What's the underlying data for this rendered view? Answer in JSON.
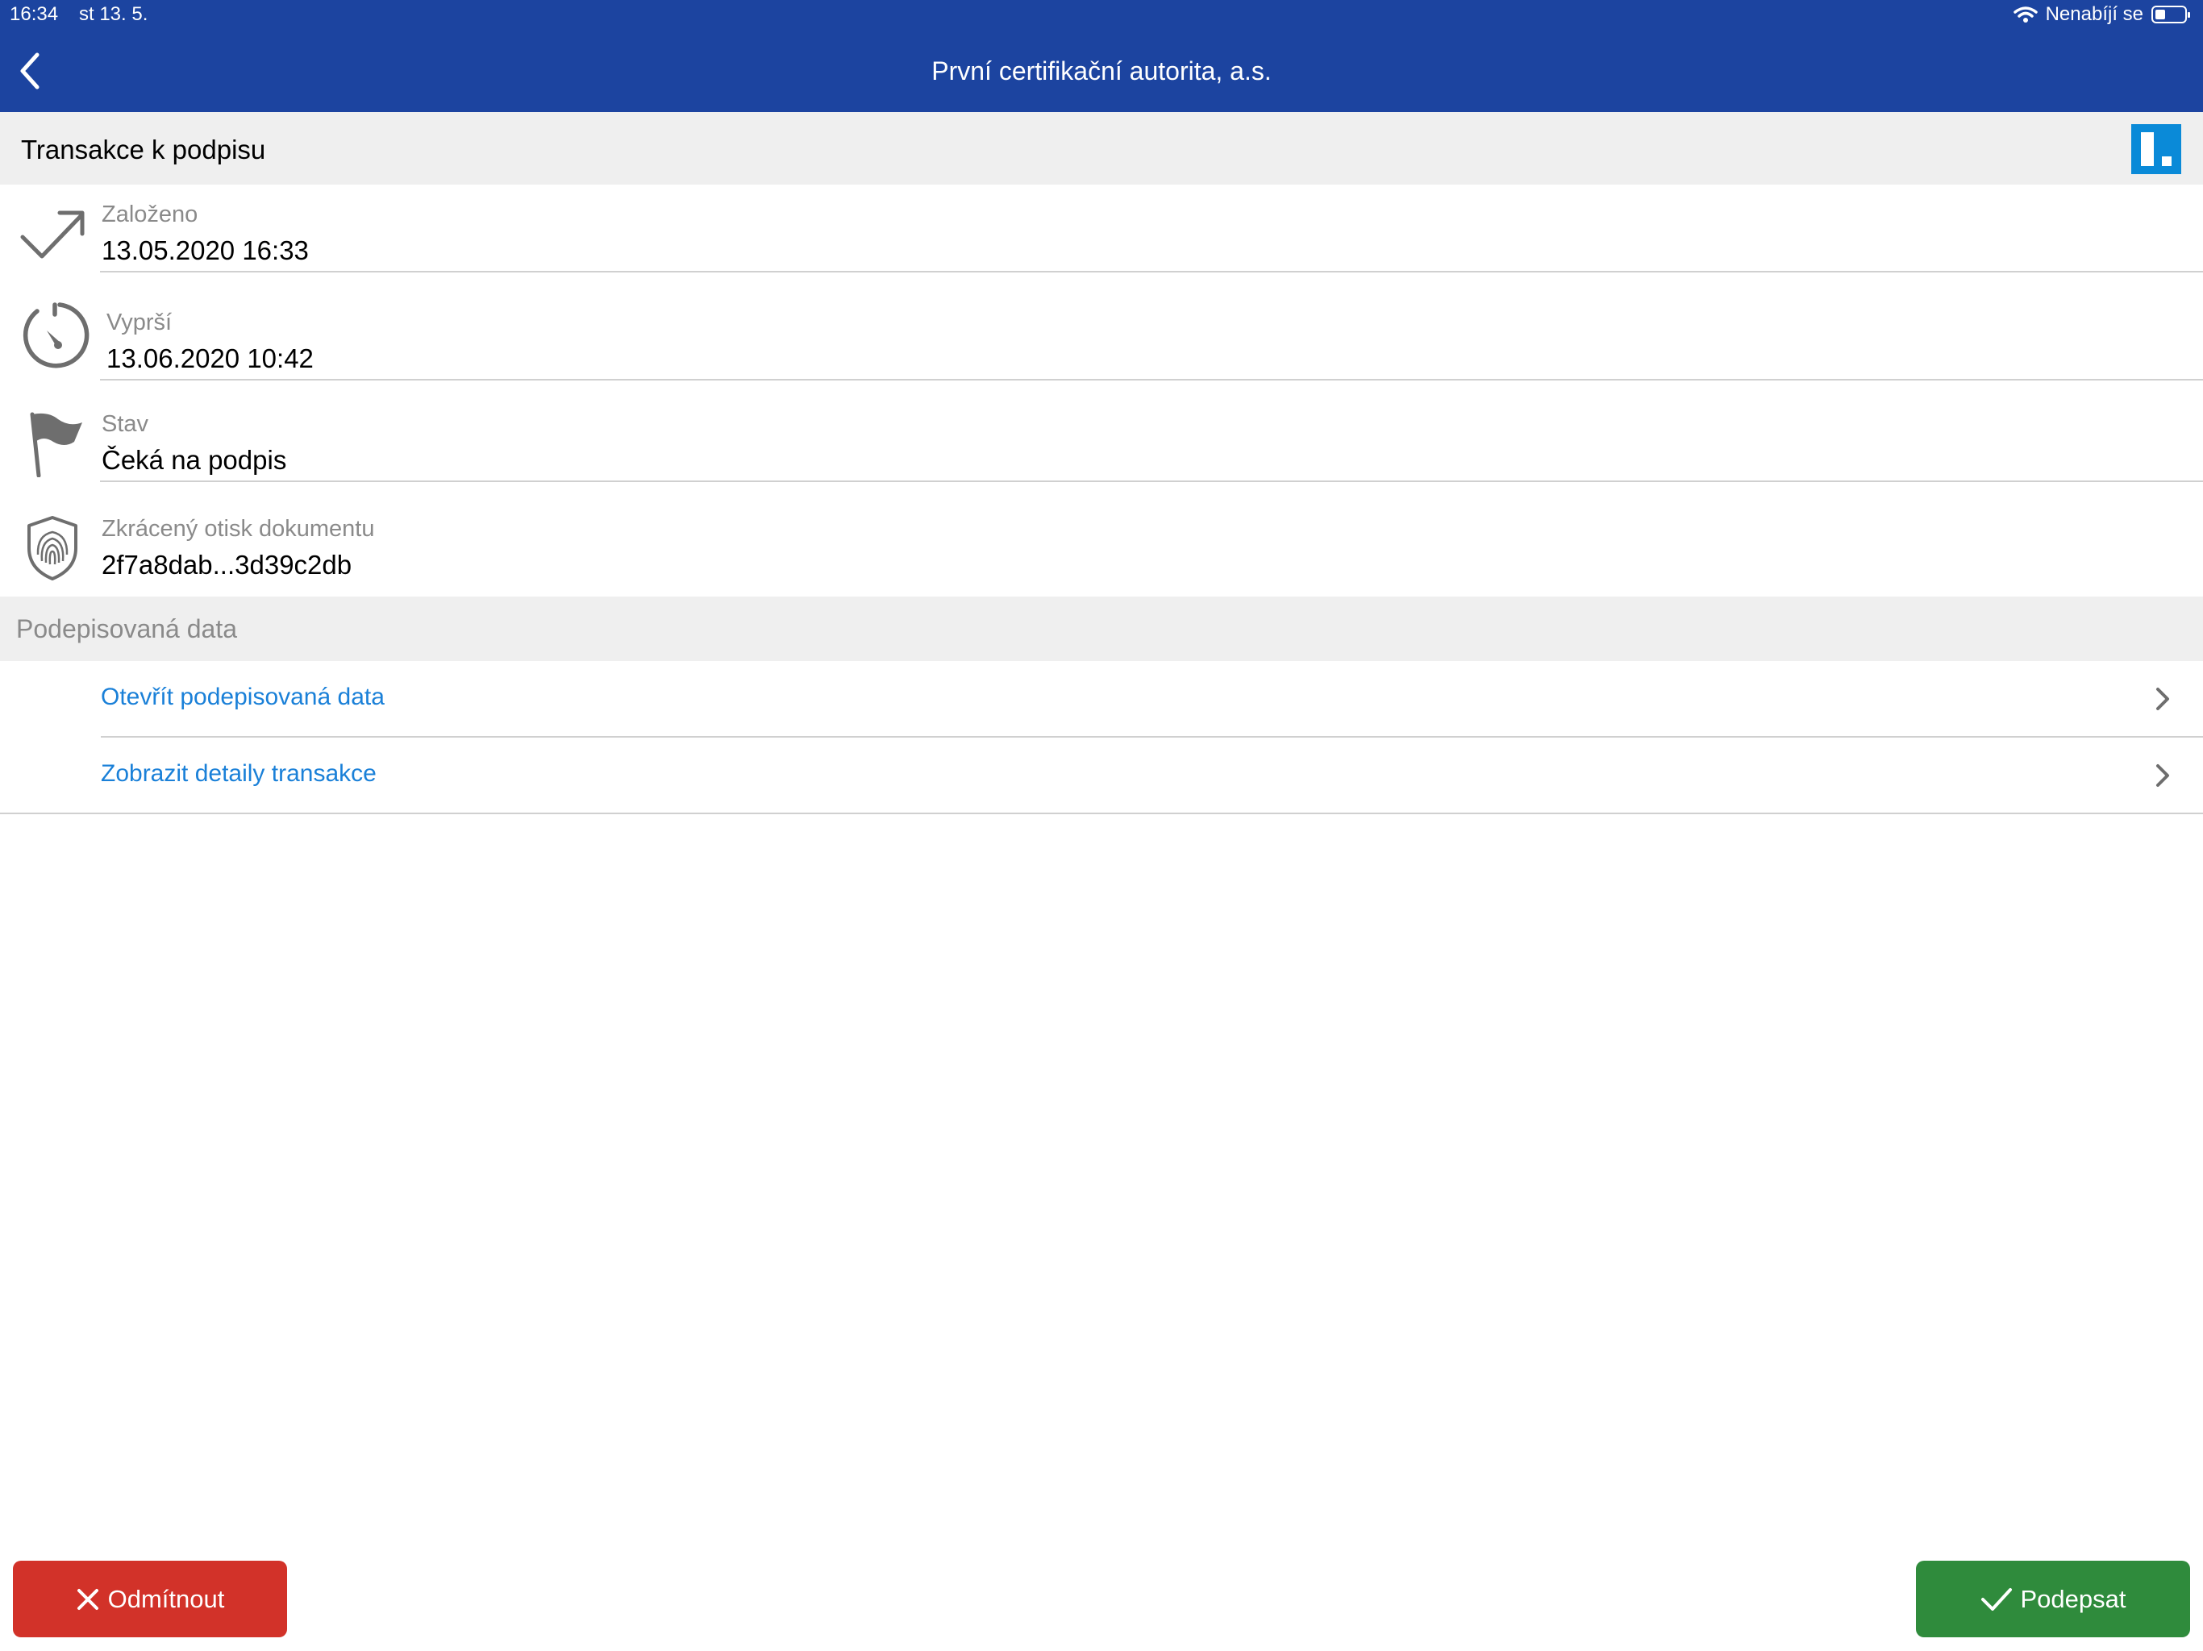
{
  "status_bar": {
    "time": "16:34",
    "date": "st 13. 5.",
    "charging": "Nenabíjí se"
  },
  "nav": {
    "title": "První certifikační autorita, a.s."
  },
  "header": {
    "title": "Transakce k podpisu"
  },
  "fields": [
    {
      "label": "Založeno",
      "value": "13.05.2020 16:33",
      "icon": "trend-arrow-icon"
    },
    {
      "label": "Vyprší",
      "value": "13.06.2020 10:42",
      "icon": "timer-icon"
    },
    {
      "label": "Stav",
      "value": "Čeká na podpis",
      "icon": "flag-icon"
    },
    {
      "label": "Zkrácený otisk dokumentu",
      "value": "2f7a8dab...3d39c2db",
      "icon": "fingerprint-shield-icon"
    }
  ],
  "signed_data": {
    "title": "Podepisovaná data",
    "links": [
      {
        "label": "Otevřít podepisovaná data"
      },
      {
        "label": "Zobrazit detaily transakce"
      }
    ]
  },
  "actions": {
    "reject_label": "Odmítnout",
    "sign_label": "Podepsat"
  },
  "colors": {
    "nav": "#1c44a0",
    "link": "#1a80d8",
    "reject": "#d23229",
    "sign": "#2f8b3c",
    "logo": "#0a8ad8"
  }
}
